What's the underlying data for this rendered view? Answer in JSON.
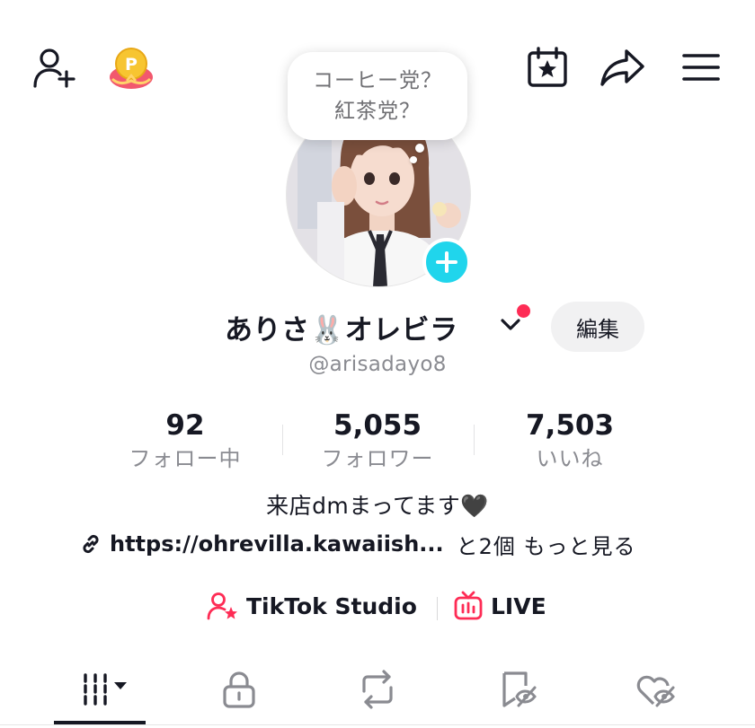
{
  "header": {
    "icons": [
      "add-friend-icon",
      "points-coin-icon",
      "calendar-star-icon",
      "share-icon",
      "menu-icon"
    ]
  },
  "bubble": {
    "line1": "コーヒー党？",
    "line2": "紅茶党？"
  },
  "profile": {
    "display_name": "ありさ🐰オレビラ",
    "handle": "@arisadayo8",
    "edit_label": "編集",
    "bio": "来店dmまってます🖤",
    "link_text": "https://ohrevilla.kawaiish...",
    "link_more": "と2個 もっと見る"
  },
  "stats": [
    {
      "value": "92",
      "label": "フォロー中"
    },
    {
      "value": "5,055",
      "label": "フォロワー"
    },
    {
      "value": "7,503",
      "label": "いいね"
    }
  ],
  "tools": {
    "studio_label": "TikTok Studio",
    "live_label": "LIVE"
  },
  "tabs": [
    "videos-grid-icon",
    "lock-icon",
    "repost-icon",
    "favorites-icon",
    "liked-icon"
  ],
  "colors": {
    "accent": "#fe2c55",
    "badge": "#20d5ec",
    "text": "#161823",
    "muted": "#8a8b91",
    "points_yellow": "#f7c531",
    "points_pink": "#f2586e"
  }
}
